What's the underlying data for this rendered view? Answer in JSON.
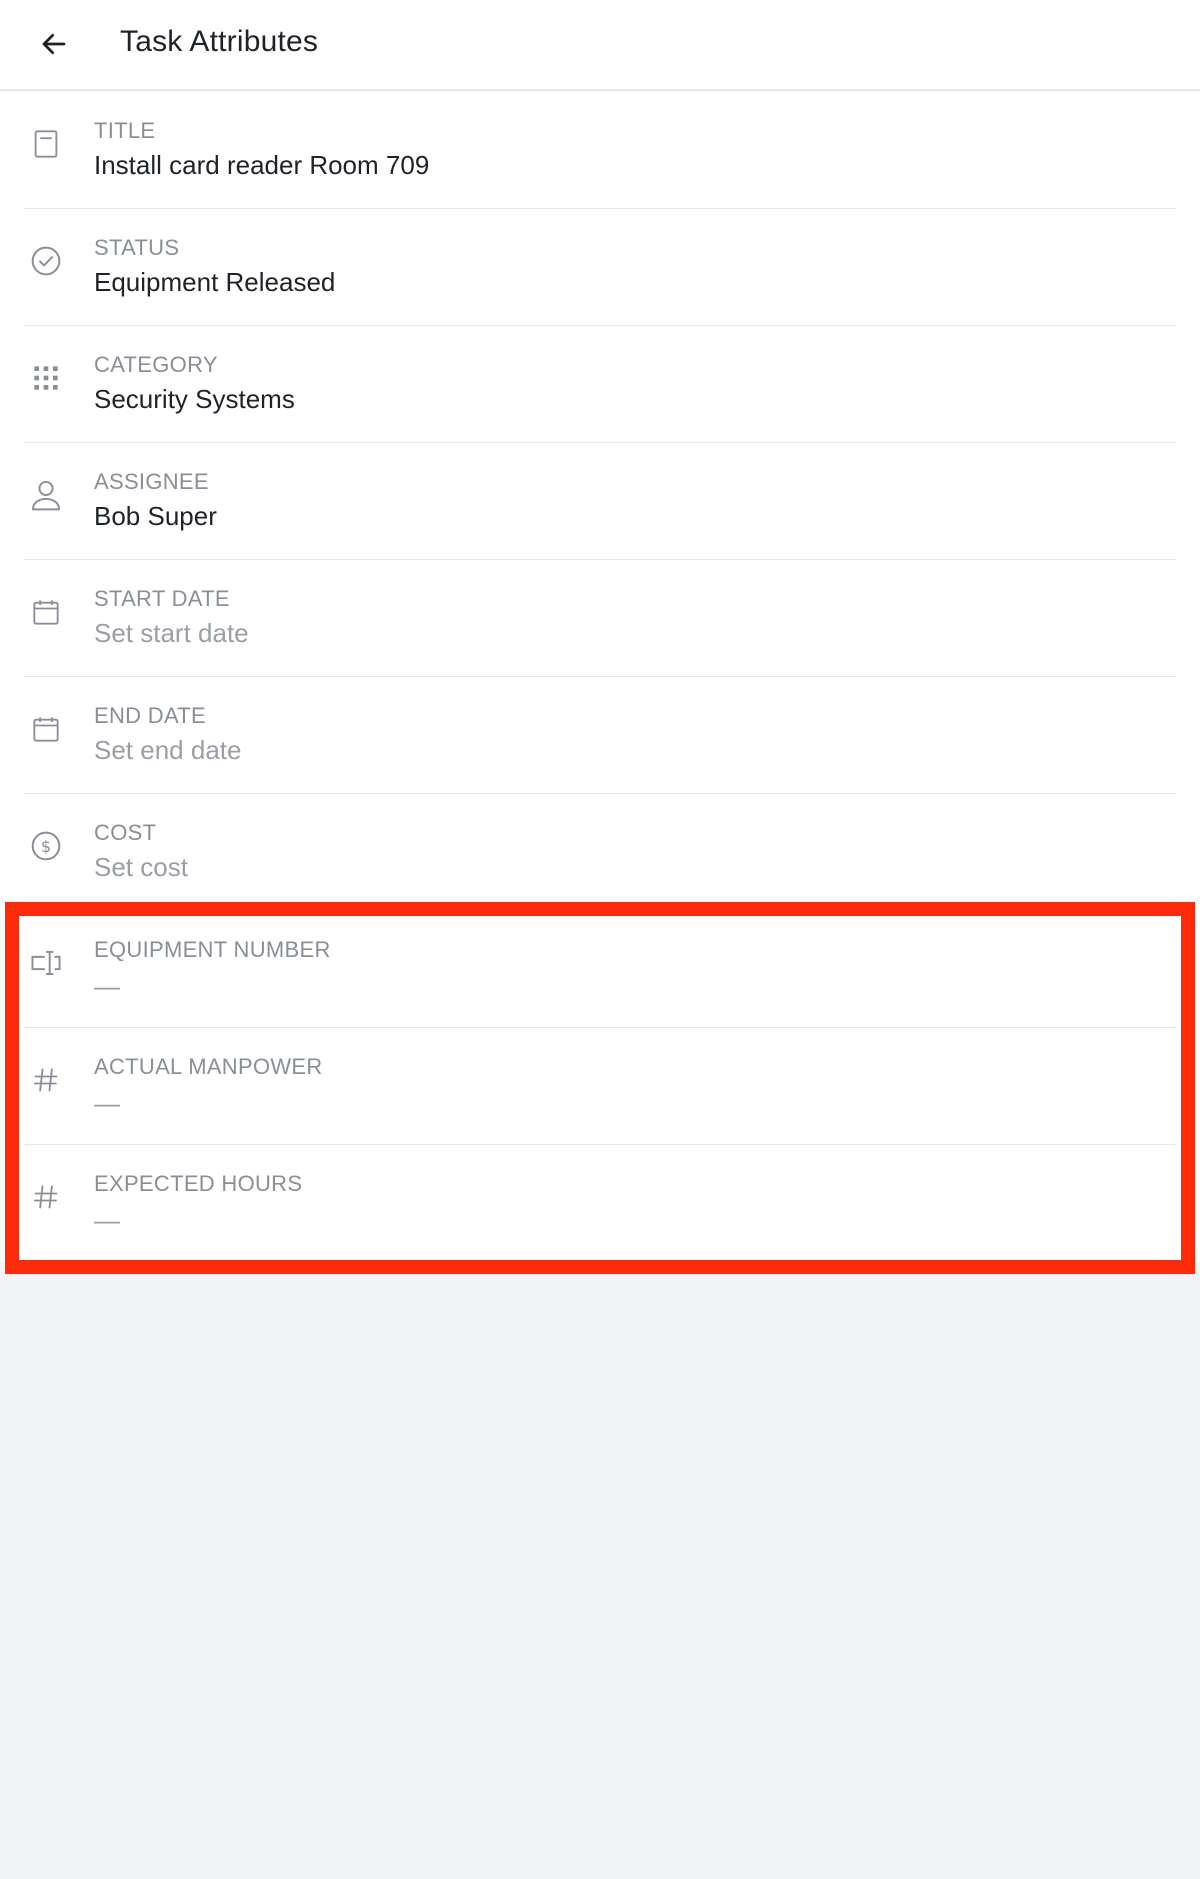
{
  "header": {
    "title": "Task Attributes",
    "back_icon": "arrow-left-icon"
  },
  "attributes": [
    {
      "label": "TITLE",
      "value": "Install card reader Room 709",
      "icon": "document-icon",
      "state": "filled"
    },
    {
      "label": "STATUS",
      "value": "Equipment Released",
      "icon": "check-circle-icon",
      "state": "filled"
    },
    {
      "label": "CATEGORY",
      "value": "Security Systems",
      "icon": "grid-icon",
      "state": "filled"
    },
    {
      "label": "ASSIGNEE",
      "value": "Bob Super",
      "icon": "person-icon",
      "state": "filled"
    },
    {
      "label": "START DATE",
      "value": "Set start date",
      "icon": "calendar-icon",
      "state": "placeholder"
    },
    {
      "label": "END DATE",
      "value": "Set end date",
      "icon": "calendar-icon",
      "state": "placeholder"
    },
    {
      "label": "COST",
      "value": "Set cost",
      "icon": "dollar-circle-icon",
      "state": "placeholder"
    },
    {
      "label": "EQUIPMENT NUMBER",
      "value": "—",
      "icon": "text-field-icon",
      "state": "empty"
    },
    {
      "label": "ACTUAL MANPOWER",
      "value": "—",
      "icon": "hash-icon",
      "state": "empty"
    },
    {
      "label": "EXPECTED HOURS",
      "value": "—",
      "icon": "hash-icon",
      "state": "empty"
    }
  ],
  "colors": {
    "highlight": "#ff2a0a",
    "background": "#f3f4f6",
    "text_primary": "#1f2328",
    "text_secondary": "#8a8f96"
  }
}
